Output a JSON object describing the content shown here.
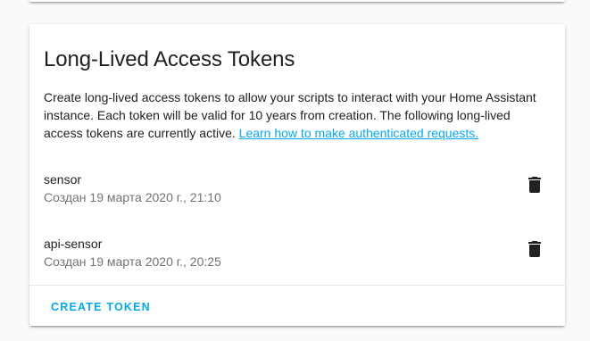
{
  "card": {
    "title": "Long-Lived Access Tokens",
    "description": "Create long-lived access tokens to allow your scripts to interact with your Home Assistant instance. Each token will be valid for 10 years from creation. The following long-lived access tokens are currently active.",
    "learn_more_link": "Learn how to make authenticated requests."
  },
  "tokens": [
    {
      "name": "sensor",
      "created": "Создан 19 марта 2020 г., 21:10",
      "delete_icon": "trash-icon"
    },
    {
      "name": "api-sensor",
      "created": "Создан 19 марта 2020 г., 20:25",
      "delete_icon": "trash-icon"
    }
  ],
  "actions": {
    "create_token_label": "CREATE TOKEN"
  },
  "colors": {
    "accent": "#03a9f4",
    "primary_text": "#212121",
    "secondary_text": "#737373",
    "icon": "#212121",
    "background": "#fafafa"
  }
}
